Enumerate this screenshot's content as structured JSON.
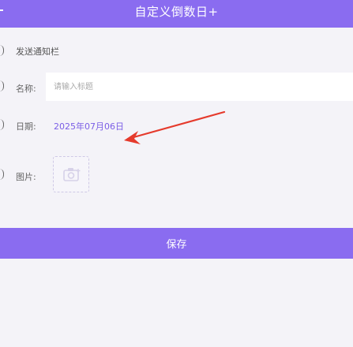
{
  "header": {
    "title": "自定义倒数日+"
  },
  "form": {
    "notify_label": "发送通知栏",
    "name_label": "名称:",
    "name_placeholder": "请输入标题",
    "date_label": "日期:",
    "date_value": "2025年07月06日",
    "image_label": "图片:"
  },
  "save_label": "保存",
  "colors": {
    "accent": "#8a6cf0",
    "arrow": "#e53a2c",
    "background": "#f4f3f8"
  },
  "icons": {
    "back": "back-icon",
    "camera": "camera-icon",
    "arrow": "annotation-arrow"
  }
}
